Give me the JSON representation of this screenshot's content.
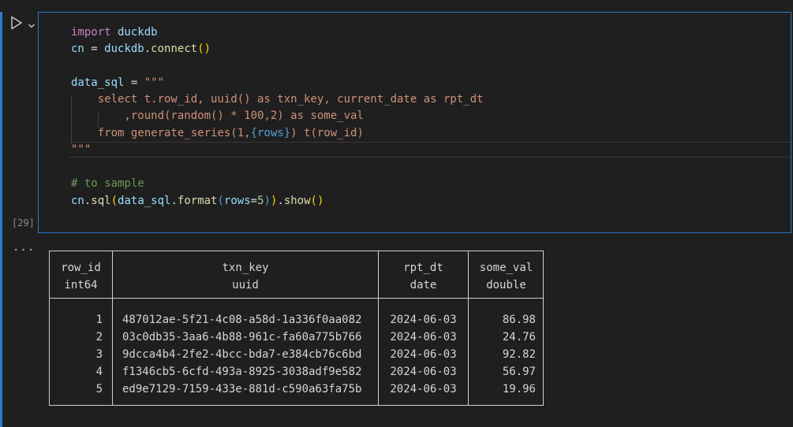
{
  "cell": {
    "execution_count": "[29]",
    "output_marker": "...",
    "run_icon": "play-icon",
    "chevron_icon": "chevron-down-icon"
  },
  "code": {
    "lines": [
      [
        {
          "t": "import",
          "c": "kw"
        },
        {
          "t": " duckdb",
          "c": "var"
        }
      ],
      [
        {
          "t": "cn",
          "c": "var"
        },
        {
          "t": " = ",
          "c": "plain"
        },
        {
          "t": "duckdb",
          "c": "var"
        },
        {
          "t": ".",
          "c": "plain"
        },
        {
          "t": "connect",
          "c": "fn"
        },
        {
          "t": "()",
          "c": "paren"
        }
      ],
      [],
      [
        {
          "t": "data_sql",
          "c": "var"
        },
        {
          "t": " = ",
          "c": "plain"
        },
        {
          "t": "\"\"\"",
          "c": "str"
        }
      ],
      [
        {
          "t": "    select t.row_id, uuid() as txn_key, current_date as rpt_dt",
          "c": "str"
        }
      ],
      [
        {
          "t": "        ,round(random() * 100,2) as some_val",
          "c": "str"
        }
      ],
      [
        {
          "t": "    from generate_series(1,",
          "c": "str"
        },
        {
          "t": "{rows}",
          "c": "interp"
        },
        {
          "t": ") t(row_id)",
          "c": "str"
        }
      ],
      [
        {
          "t": "\"\"\"",
          "c": "str"
        }
      ],
      [],
      [
        {
          "t": "# to sample",
          "c": "comment"
        }
      ],
      [
        {
          "t": "cn",
          "c": "var"
        },
        {
          "t": ".",
          "c": "plain"
        },
        {
          "t": "sql",
          "c": "fn"
        },
        {
          "t": "(",
          "c": "paren"
        },
        {
          "t": "data_sql",
          "c": "var"
        },
        {
          "t": ".",
          "c": "plain"
        },
        {
          "t": "format",
          "c": "fn"
        },
        {
          "t": "(",
          "c": "interp"
        },
        {
          "t": "rows",
          "c": "param"
        },
        {
          "t": "=",
          "c": "plain"
        },
        {
          "t": "5",
          "c": "num"
        },
        {
          "t": ")",
          "c": "interp"
        },
        {
          "t": ")",
          "c": "paren"
        },
        {
          "t": ".",
          "c": "plain"
        },
        {
          "t": "show",
          "c": "fn"
        },
        {
          "t": "()",
          "c": "paren"
        }
      ]
    ]
  },
  "output": {
    "columns": [
      {
        "name": "row_id",
        "type": "int64"
      },
      {
        "name": "txn_key",
        "type": "uuid"
      },
      {
        "name": "rpt_dt",
        "type": "date"
      },
      {
        "name": "some_val",
        "type": "double"
      }
    ],
    "rows": [
      [
        "1",
        "487012ae-5f21-4c08-a58d-1a336f0aa082",
        "2024-06-03",
        "86.98"
      ],
      [
        "2",
        "03c0db35-3aa6-4b88-961c-fa60a775b766",
        "2024-06-03",
        "24.76"
      ],
      [
        "3",
        "9dcca4b4-2fe2-4bcc-bda7-e384cb76c6bd",
        "2024-06-03",
        "92.82"
      ],
      [
        "4",
        "f1346cb5-6cfd-493a-8925-3038adf9e582",
        "2024-06-03",
        "56.97"
      ],
      [
        "5",
        "ed9e7129-7159-433e-881d-c590a63fa75b",
        "2024-06-03",
        "19.96"
      ]
    ]
  },
  "colors": {
    "accent": "#2b79d0",
    "background": "#1f1f1f"
  }
}
